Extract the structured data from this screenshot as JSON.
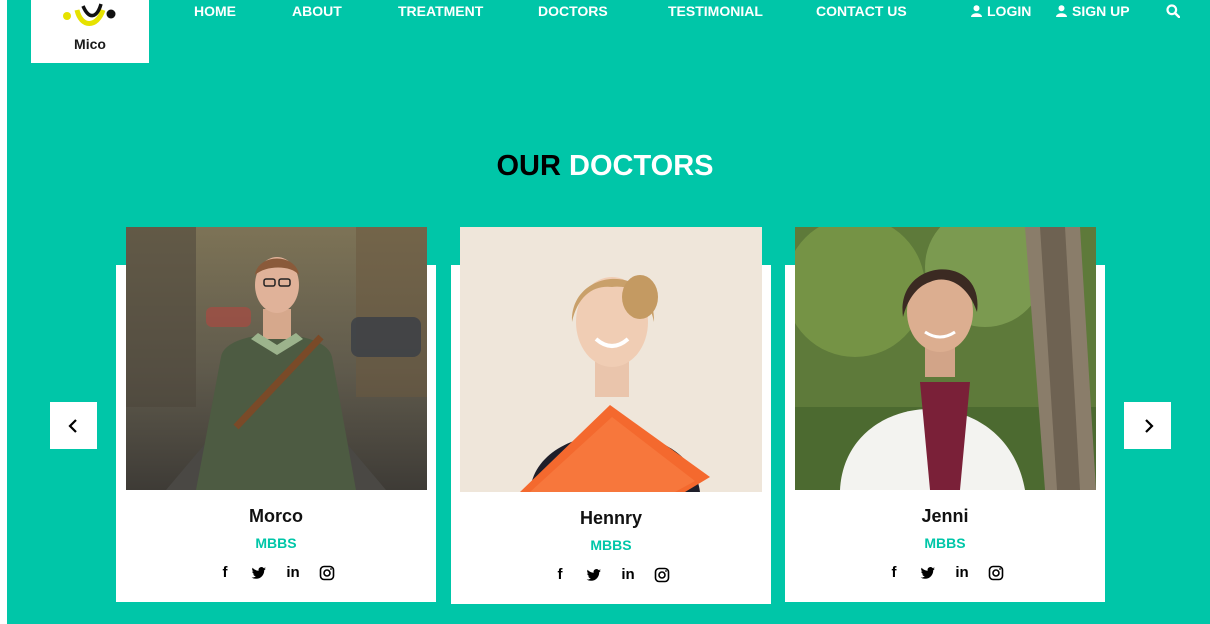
{
  "brand": {
    "name": "Mico"
  },
  "nav": {
    "items": [
      "HOME",
      "ABOUT",
      "TREATMENT",
      "DOCTORS",
      "TESTIMONIAL",
      "CONTACT US"
    ],
    "login": "LOGIN",
    "signup": "SIGN UP"
  },
  "section": {
    "title_part1": "OUR",
    "title_part2": "DOCTORS"
  },
  "doctors": [
    {
      "name": "Morco",
      "degree": "MBBS"
    },
    {
      "name": "Hennry",
      "degree": "MBBS"
    },
    {
      "name": "Jenni",
      "degree": "MBBS"
    }
  ],
  "socials": {
    "facebook": "f",
    "linkedin": "in"
  },
  "colors": {
    "accent": "#00c6a8",
    "card": "#ffffff",
    "logo_yellow": "#e6e200"
  },
  "icons": [
    "logo-icon",
    "user-icon",
    "search-icon",
    "facebook-icon",
    "twitter-icon",
    "linkedin-icon",
    "instagram-icon",
    "chevron-left-icon",
    "chevron-right-icon"
  ]
}
